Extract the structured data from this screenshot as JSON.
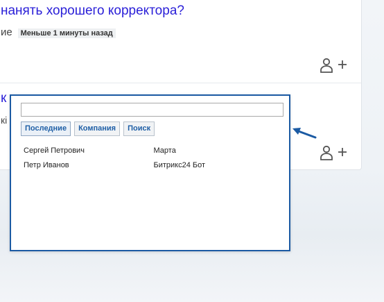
{
  "question1": {
    "title": "нанять хорошего корректора?",
    "meta_truncated": "ие",
    "time_badge": "Меньше 1 минуты назад",
    "follow_icon": "add-user-icon"
  },
  "question2": {
    "title_fragment": "к",
    "meta_fragment": "кі",
    "follow_icon": "add-user-icon"
  },
  "picker": {
    "search": {
      "value": "",
      "placeholder": ""
    },
    "tabs": [
      {
        "label": "Последние",
        "active": true
      },
      {
        "label": "Компания",
        "active": false
      },
      {
        "label": "Поиск",
        "active": false
      }
    ],
    "contacts": [
      [
        "Сергей Петрович",
        "Марта"
      ],
      [
        "Петр Иванов",
        "Битрикс24 Бот"
      ]
    ]
  },
  "colors": {
    "link": "#2b20d8",
    "popup_border": "#1b5aa3",
    "tab_text": "#1f5fa6",
    "arrow": "#1b5aa3"
  },
  "icons": {
    "pointer": "arrow-pointer-icon"
  }
}
